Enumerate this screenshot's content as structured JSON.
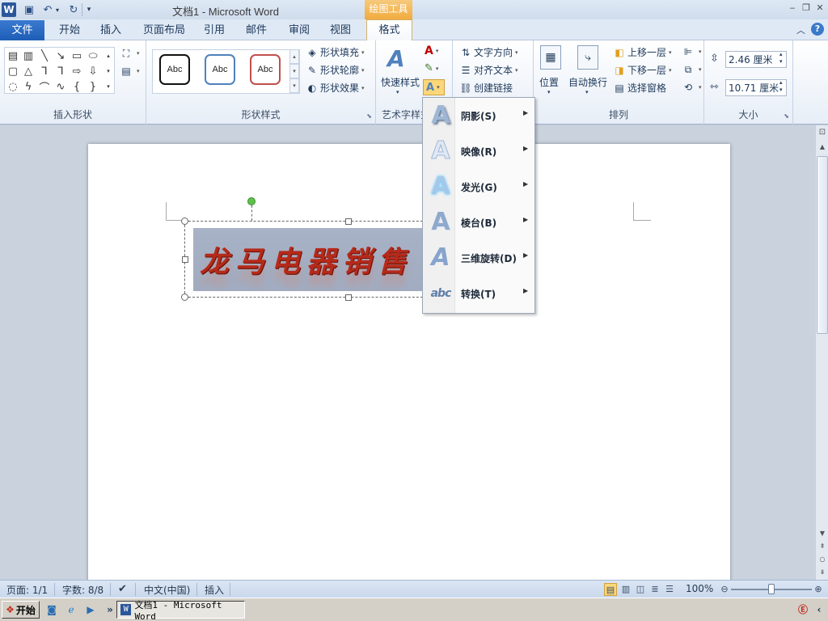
{
  "titlebar": {
    "window_title": "文档1 - Microsoft Word",
    "context_tool": "绘图工具"
  },
  "tabs": {
    "file": "文件",
    "items": [
      "开始",
      "插入",
      "页面布局",
      "引用",
      "邮件",
      "审阅",
      "视图"
    ],
    "format": "格式"
  },
  "ribbon": {
    "insert_shapes": {
      "label": "插入形状"
    },
    "shape_styles": {
      "label": "形状样式",
      "previews": [
        "Abc",
        "Abc",
        "Abc"
      ],
      "fill": "形状填充",
      "outline": "形状轮廓",
      "effects": "形状效果"
    },
    "wordart": {
      "label": "艺术字样式",
      "quick_styles": "快速样式"
    },
    "text": {
      "direction": "文字方向",
      "align": "对齐文本",
      "link": "创建链接"
    },
    "arrange": {
      "label": "排列",
      "position": "位置",
      "wrap": "自动换行",
      "bring_forward": "上移一层",
      "send_backward": "下移一层",
      "selection_pane": "选择窗格"
    },
    "size": {
      "label": "大小",
      "height": "2.46 厘米",
      "width": "10.71 厘米"
    }
  },
  "document": {
    "wordart_text": "龙马电器销售"
  },
  "menu": {
    "items": [
      {
        "label": "阴影(S)",
        "icon": "shadow-icon"
      },
      {
        "label": "映像(R)",
        "icon": "reflection-icon"
      },
      {
        "label": "发光(G)",
        "icon": "glow-icon"
      },
      {
        "label": "棱台(B)",
        "icon": "bevel-icon"
      },
      {
        "label": "三维旋转(D)",
        "icon": "3d-rotation-icon"
      },
      {
        "label": "转换(T)",
        "icon": "transform-icon"
      }
    ]
  },
  "statusbar": {
    "page": "页面: 1/1",
    "words": "字数: 8/8",
    "language": "中文(中国)",
    "mode": "插入",
    "zoom": "100%"
  },
  "taskbar": {
    "start": "开始",
    "word_task": "文档1 - Microsoft Word"
  },
  "colors": {
    "accent": "#2b579a",
    "context_tab": "#f1ab3d",
    "wordart_fill": "#b52a1a"
  }
}
